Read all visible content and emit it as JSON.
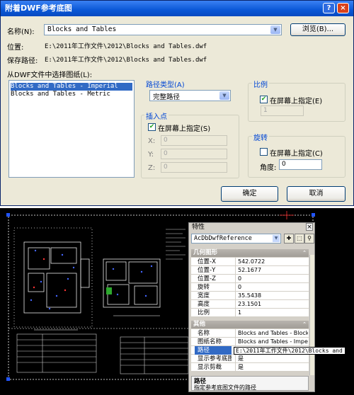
{
  "dialog": {
    "title": "附着DWF参考底图",
    "help_icon": "?",
    "close_icon": "×",
    "name_label": "名称(N):",
    "name_value": "Blocks and Tables",
    "browse_button": "浏览(B)...",
    "location_label": "位置:",
    "location_value": "E:\\2011年工作文件\\2012\\Blocks and Tables.dwf",
    "saved_path_label": "保存路径:",
    "saved_path_value": "E:\\2011年工作文件\\2012\\Blocks and Tables.dwf",
    "select_label": "从DWF文件中选择图纸(L):",
    "sheets": [
      "Blocks and Tables - Imperial",
      "Blocks and Tables - Metric"
    ],
    "path_type": {
      "title": "路径类型(A)",
      "value": "完整路径"
    },
    "insertion_point": {
      "title": "插入点",
      "on_screen": "在屏幕上指定(S)",
      "x_label": "X:",
      "y_label": "Y:",
      "z_label": "Z:",
      "x": "0",
      "y": "0",
      "z": "0"
    },
    "scale": {
      "title": "比例",
      "on_screen": "在屏幕上指定(E)",
      "value": "1"
    },
    "rotation": {
      "title": "旋转",
      "on_screen": "在屏幕上指定(C)",
      "angle_label": "角度:",
      "angle": "0"
    },
    "ok_button": "确定",
    "cancel_button": "取消"
  },
  "palette": {
    "title": "特性",
    "close_icon": "×",
    "object_type": "AcDbDwfReference",
    "sections": {
      "geometry": "几何图形",
      "other": "其他"
    },
    "geometry_rows": [
      {
        "k": "位置-X",
        "v": "542.0722"
      },
      {
        "k": "位置-Y",
        "v": "52.1677"
      },
      {
        "k": "位置-Z",
        "v": "0"
      },
      {
        "k": "旋转",
        "v": "0"
      },
      {
        "k": "宽度",
        "v": "35.5438"
      },
      {
        "k": "高度",
        "v": "23.1501"
      },
      {
        "k": "比例",
        "v": "1"
      }
    ],
    "other_rows": [
      {
        "k": "名称",
        "v": "Blocks and Tables - Blocks a"
      },
      {
        "k": "图纸名称",
        "v": "Blocks and Tables - Imperial"
      },
      {
        "k": "路径",
        "v": "E:\\2011年工作文件\\2012\\Bl"
      },
      {
        "k": "显示参考底图",
        "v": "是"
      },
      {
        "k": "显示剪裁",
        "v": "是"
      }
    ],
    "path_tooltip": "E:\\2011年工作文件\\2012\\Blocks and Tables.dwf",
    "desc_title": "路径",
    "desc_text": "指定参考底图文件的路径"
  },
  "colors": {
    "title_bar": "#0a57d6",
    "group_title": "#0046d5",
    "cad_bg": "#000000",
    "selection": "#316ac5"
  }
}
